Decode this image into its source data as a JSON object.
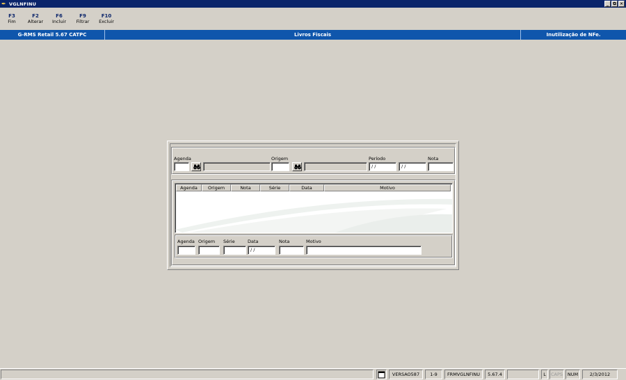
{
  "window": {
    "title": "VGLNFINU",
    "icon": "app-pen-icon"
  },
  "function_keys": [
    {
      "key": "F3",
      "label": "Fim"
    },
    {
      "key": "F2",
      "label": "Alterar"
    },
    {
      "key": "F6",
      "label": "Incluir"
    },
    {
      "key": "F9",
      "label": "Filtrar"
    },
    {
      "key": "F10",
      "label": "Excluir"
    }
  ],
  "header": {
    "system": "G-RMS Retail 5.67 CATPC",
    "module": "Livros Fiscais",
    "screen": "Inutilização de NFe."
  },
  "filter": {
    "agenda_label": "Agenda",
    "agenda_value": "",
    "agenda_desc": "",
    "origem_label": "Origem",
    "origem_value": "",
    "origem_desc": "",
    "periodo_label": "Período",
    "periodo_from": " / /",
    "periodo_to": " / /",
    "nota_label": "Nota",
    "nota_value": ""
  },
  "grid": {
    "columns": [
      "Agenda",
      "Origem",
      "Nota",
      "Série",
      "Data",
      "Motivo"
    ],
    "rows": []
  },
  "detail": {
    "agenda_label": "Agenda",
    "agenda_value": "",
    "origem_label": "Origem",
    "origem_value": "",
    "serie_label": "Série",
    "serie_value": "",
    "data_label": "Data",
    "data_value": " / /",
    "nota_label": "Nota",
    "nota_value": "",
    "motivo_label": "Motivo",
    "motivo_value": ""
  },
  "statusbar": {
    "version_label": "VERSAO587",
    "page": "1-9",
    "form": "FRMVGLNFINU",
    "build": "5.67.4",
    "empty": "",
    "l": "L",
    "caps": "CAPS",
    "num": "NUM",
    "date": "2/3/2012"
  },
  "colors": {
    "titlebar": "#0a246a",
    "header": "#0f56ac",
    "face": "#d4d0c8"
  }
}
